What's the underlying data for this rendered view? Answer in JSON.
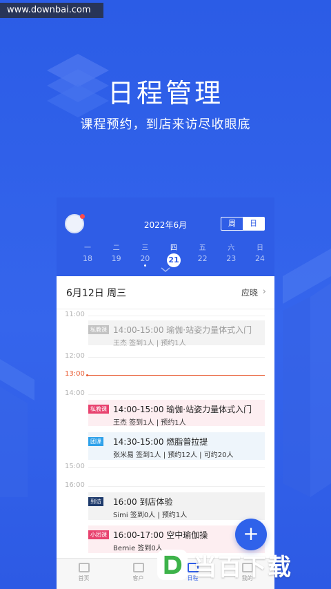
{
  "watermark": {
    "site": "www.downbai.com",
    "brand": "当百下载"
  },
  "hero": {
    "title": "日程管理",
    "subtitle": "课程预约，到店来访尽收眼底"
  },
  "app": {
    "header": {
      "month": "2022年6月",
      "view_toggle": [
        {
          "label": "周",
          "active": false
        },
        {
          "label": "日",
          "active": true
        }
      ],
      "week": [
        {
          "weekday": "一",
          "date": "18",
          "today": false,
          "has_event": false
        },
        {
          "weekday": "二",
          "date": "19",
          "today": false,
          "has_event": false
        },
        {
          "weekday": "三",
          "date": "20",
          "today": false,
          "has_event": true
        },
        {
          "weekday": "四",
          "date": "21",
          "today": true,
          "has_event": false
        },
        {
          "weekday": "五",
          "date": "22",
          "today": false,
          "has_event": false
        },
        {
          "weekday": "六",
          "date": "23",
          "today": false,
          "has_event": false
        },
        {
          "weekday": "日",
          "date": "24",
          "today": false,
          "has_event": false
        }
      ]
    },
    "date_bar": {
      "title": "6月12日 周三",
      "right_label": "应晓"
    },
    "times": {
      "t1100": "11:00",
      "t1200": "12:00",
      "now": "13:00",
      "t1400": "14:00",
      "t1500": "15:00",
      "t1600": "16:00"
    },
    "events": [
      {
        "tag": "私教课",
        "tag_color": "#c3c3c3",
        "bg": "#f3f3f3",
        "title": "14:00-15:00 瑜伽·站姿力量体式入门",
        "meta": "王杰  签到1人 | 预约1人",
        "muted": true
      },
      {
        "tag": "私教课",
        "tag_color": "#e8436f",
        "bg": "#fdeef1",
        "title": "14:00-15:00 瑜伽·站姿力量体式入门",
        "meta": "王杰  签到1人 | 预约1人",
        "muted": false
      },
      {
        "tag": "团课",
        "tag_color": "#2ea1ea",
        "bg": "#eef5fb",
        "title": "14:30-15:00 燃脂普拉提",
        "meta": "张米易  签到1人 | 预约12人 | 可约20人",
        "muted": false
      },
      {
        "tag": "到访",
        "tag_color": "#1e3a6b",
        "bg": "#f2f2f2",
        "title": "16:00 到店体验",
        "meta": "Simi  签到0人 | 预约1人",
        "muted": false
      },
      {
        "tag": "小团课",
        "tag_color": "#e8436f",
        "bg": "#fdeef1",
        "title": "16:00-17:00 空中瑜伽操",
        "meta": "Bernie  签到0人",
        "muted": false
      }
    ],
    "fab_label": "+",
    "tabs": [
      {
        "label": "首页",
        "active": false
      },
      {
        "label": "客户",
        "active": false
      },
      {
        "label": "日程",
        "active": true
      },
      {
        "label": "我的",
        "active": false
      }
    ]
  }
}
